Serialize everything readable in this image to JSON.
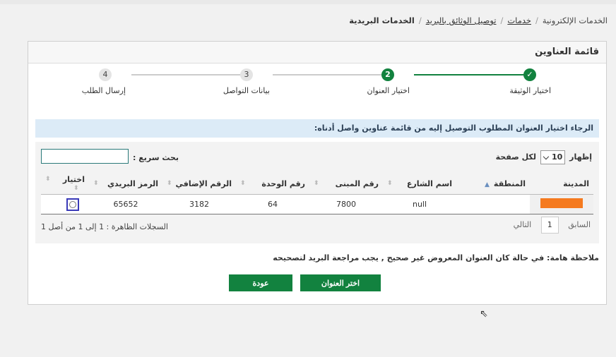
{
  "breadcrumb": {
    "items": [
      "الخدمات الإلكترونية",
      "خدمات",
      "توصيل الوثائق بالبريد",
      "الخدمات البريدية"
    ],
    "separator": "/"
  },
  "panel": {
    "title": "قائمة العناوين"
  },
  "stepper": {
    "steps": [
      {
        "number": "✓",
        "label": "اختيار الوثيقة",
        "state": "done"
      },
      {
        "number": "2",
        "label": "اختيار العنوان",
        "state": "active"
      },
      {
        "number": "3",
        "label": "بيانات التواصل",
        "state": "todo"
      },
      {
        "number": "4",
        "label": "إرسال الطلب",
        "state": "todo"
      }
    ]
  },
  "instruction": "الرجاء اختيار العنوان المطلوب التوصيل إليه من قائمة عناوين واصل أدناه:",
  "table_controls": {
    "show_prefix": "إظهار",
    "page_size": "10",
    "show_suffix": "لكل صفحة",
    "search_label": "بحث سريع :",
    "search_value": ""
  },
  "table": {
    "headers": [
      "المدينة",
      "المنطقة",
      "اسم الشارع",
      "رقم المبنى",
      "رقم الوحدة",
      "الرقم الإضافي",
      "الرمز البريدي",
      "اختيار"
    ],
    "rows": [
      {
        "city": "",
        "region": "",
        "street": "null",
        "building": "7800",
        "unit": "64",
        "additional": "3182",
        "postal": "65652"
      }
    ]
  },
  "pagination": {
    "previous": "السابق",
    "page": "1",
    "next": "التالي",
    "records": "السجلات الظاهرة : 1 إلى 1 من أصل 1"
  },
  "note": "ملاحظة هامة: في حالة كان العنوان المعروض غير صحيح , يجب مراجعة البريد لتصحيحه",
  "buttons": {
    "choose": "اختر العنوان",
    "back": "عودة"
  },
  "colors": {
    "primary_green": "#12823f",
    "info_bg": "#dcebf7",
    "highlight_orange": "#f57a1f"
  }
}
